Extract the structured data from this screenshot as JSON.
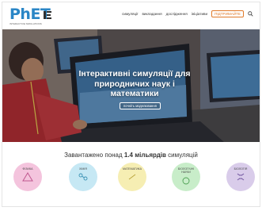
{
  "header": {
    "logo": "PhET",
    "logo_sub": "INTERACTIVE SIMULATIONS",
    "nav": [
      "симуляції",
      "викладання",
      "дослідження",
      "ініціативи"
    ],
    "donate": "ПІДТРИМАЙТЕ"
  },
  "hero": {
    "title": "Інтерактивні симуляції для природничих наук і математики",
    "button": "почніть моделювання"
  },
  "stats": {
    "prefix": "Завантажено понад ",
    "bold": "1.4 мільярдів",
    "suffix": " симуляцій"
  },
  "categories": [
    {
      "label": "фізика",
      "color": "#f4c4dd"
    },
    {
      "label": "хімія",
      "color": "#c6e8f4"
    },
    {
      "label": "математи­ка",
      "color": "#f6eeb3"
    },
    {
      "label": "біологічні науки",
      "color": "#c8edc9"
    },
    {
      "label": "біологія",
      "color": "#d9ccea"
    }
  ],
  "colors": {
    "brand": "#2a86c6",
    "donate": "#e07a2a"
  }
}
